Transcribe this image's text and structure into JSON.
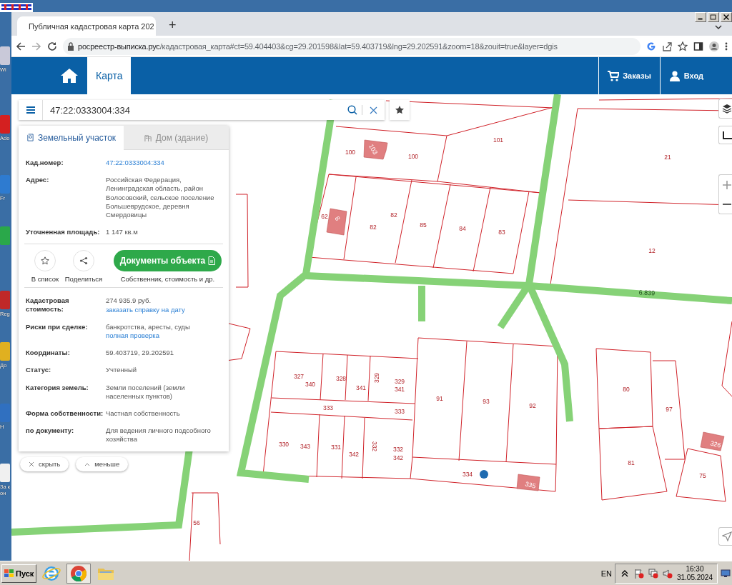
{
  "desktop": {
    "icons": [
      {
        "label": "Wi"
      },
      {
        "label": "Ado"
      },
      {
        "label": "Fr"
      },
      {
        "label": "Reg"
      },
      {
        "label": "До"
      },
      {
        "label": "Н"
      },
      {
        "label": "За кон"
      }
    ]
  },
  "browser": {
    "tabs": [
      {
        "title": "Публичная кадастровая карта 202",
        "selected": true
      }
    ],
    "new_tab": "+",
    "address": {
      "host": "росреестр-выписка.рус",
      "path": "/кадастровая_карта#ct=59.404403&cg=29.201598&lat=59.403719&lng=29.202591&zoom=18&zouit=true&layer=dgis"
    }
  },
  "site_header": {
    "nav": [
      {
        "label": "Карта",
        "selected": true
      }
    ],
    "actions": [
      {
        "kind": "cart",
        "label": "Заказы"
      },
      {
        "kind": "user",
        "label": "Вход"
      }
    ]
  },
  "search": {
    "value": "47:22:0333004:334"
  },
  "info_card": {
    "tabs": [
      {
        "label": "Земельный участок",
        "selected": true,
        "disabled": false
      },
      {
        "label": "Дом (здание)",
        "selected": false,
        "disabled": true
      }
    ],
    "fields_top": [
      {
        "label": "Кад.номер:",
        "value": [
          {
            "text": "47:22:0333004:334",
            "kind": "link"
          }
        ]
      },
      {
        "label": "Адрес:",
        "value": [
          {
            "text": "Российская Федерация, Ленинградская область, район Волосовский, сельское поселение Большеврудское, деревня Смердовицы",
            "kind": "text"
          }
        ]
      },
      {
        "label": "Уточненная площадь:",
        "value": [
          {
            "text": "1 147 кв.м",
            "kind": "text"
          }
        ]
      }
    ],
    "actions": [
      {
        "kind": "star",
        "label": "В список"
      },
      {
        "kind": "share",
        "label": "Поделиться"
      }
    ],
    "documents_button": {
      "label": "Документы объекта",
      "caption": "Собственник, стоимость и др."
    },
    "fields": [
      {
        "label": "Кадастровая стоимость:",
        "value": [
          {
            "text": "274 935.9 руб.",
            "kind": "text"
          },
          {
            "text": "заказать справку на дату",
            "kind": "link"
          }
        ]
      },
      {
        "label": "Риски при сделке:",
        "value": [
          {
            "text": "банкротства, аресты, суды",
            "kind": "text"
          },
          {
            "text": "полная проверка",
            "kind": "link"
          }
        ]
      },
      {
        "label": "Координаты:",
        "value": [
          {
            "text": "59.403719, 29.202591",
            "kind": "text"
          }
        ]
      },
      {
        "label": "Статус:",
        "value": [
          {
            "text": "Учтенный",
            "kind": "text"
          }
        ]
      },
      {
        "label": "Категория земель:",
        "value": [
          {
            "text": "Земли поселений (земли населенных пунктов)",
            "kind": "text"
          }
        ]
      },
      {
        "label": "Форма собственности:",
        "value": [
          {
            "text": "Частная собственность",
            "kind": "text"
          }
        ]
      },
      {
        "label": "по документу:",
        "value": [
          {
            "text": "Для ведения личного подсобного хозяйства",
            "kind": "text"
          }
        ]
      }
    ]
  },
  "panel_buttons": [
    {
      "kind": "close",
      "label": "скрыть"
    },
    {
      "kind": "collapse",
      "label": "меньше"
    }
  ],
  "map": {
    "labels": [
      {
        "text": "100",
        "kind": "plot"
      },
      {
        "text": "103",
        "kind": "building"
      },
      {
        "text": "100",
        "kind": "plot"
      },
      {
        "text": "101",
        "kind": "plot"
      },
      {
        "text": "21",
        "kind": "plot"
      },
      {
        "text": "62",
        "kind": "plot"
      },
      {
        "text": "8",
        "kind": "building"
      },
      {
        "text": "82",
        "kind": "plot"
      },
      {
        "text": "82",
        "kind": "plot"
      },
      {
        "text": "85",
        "kind": "plot"
      },
      {
        "text": "84",
        "kind": "plot"
      },
      {
        "text": "83",
        "kind": "plot"
      },
      {
        "text": "12",
        "kind": "plot"
      },
      {
        "text": "6.839",
        "kind": "road"
      },
      {
        "text": "327",
        "kind": "plot"
      },
      {
        "text": "340",
        "kind": "plot"
      },
      {
        "text": "328",
        "kind": "plot"
      },
      {
        "text": "341",
        "kind": "plot"
      },
      {
        "text": "329",
        "kind": "plot"
      },
      {
        "text": "329",
        "kind": "plot"
      },
      {
        "text": "341",
        "kind": "plot"
      },
      {
        "text": "333",
        "kind": "plot"
      },
      {
        "text": "333",
        "kind": "plot"
      },
      {
        "text": "91",
        "kind": "plot"
      },
      {
        "text": "93",
        "kind": "plot"
      },
      {
        "text": "92",
        "kind": "plot"
      },
      {
        "text": "80",
        "kind": "plot"
      },
      {
        "text": "97",
        "kind": "plot"
      },
      {
        "text": "330",
        "kind": "plot"
      },
      {
        "text": "343",
        "kind": "plot"
      },
      {
        "text": "331",
        "kind": "plot"
      },
      {
        "text": "342",
        "kind": "plot"
      },
      {
        "text": "332",
        "kind": "plot"
      },
      {
        "text": "332",
        "kind": "plot"
      },
      {
        "text": "342",
        "kind": "plot"
      },
      {
        "text": "334",
        "kind": "plot"
      },
      {
        "text": "335",
        "kind": "building"
      },
      {
        "text": "81",
        "kind": "plot"
      },
      {
        "text": "326",
        "kind": "building"
      },
      {
        "text": "75",
        "kind": "plot"
      },
      {
        "text": "56",
        "kind": "plot"
      }
    ]
  },
  "taskbar": {
    "start": "Пуск",
    "language": "EN",
    "time": "16:30",
    "date": "31.05.2024"
  }
}
